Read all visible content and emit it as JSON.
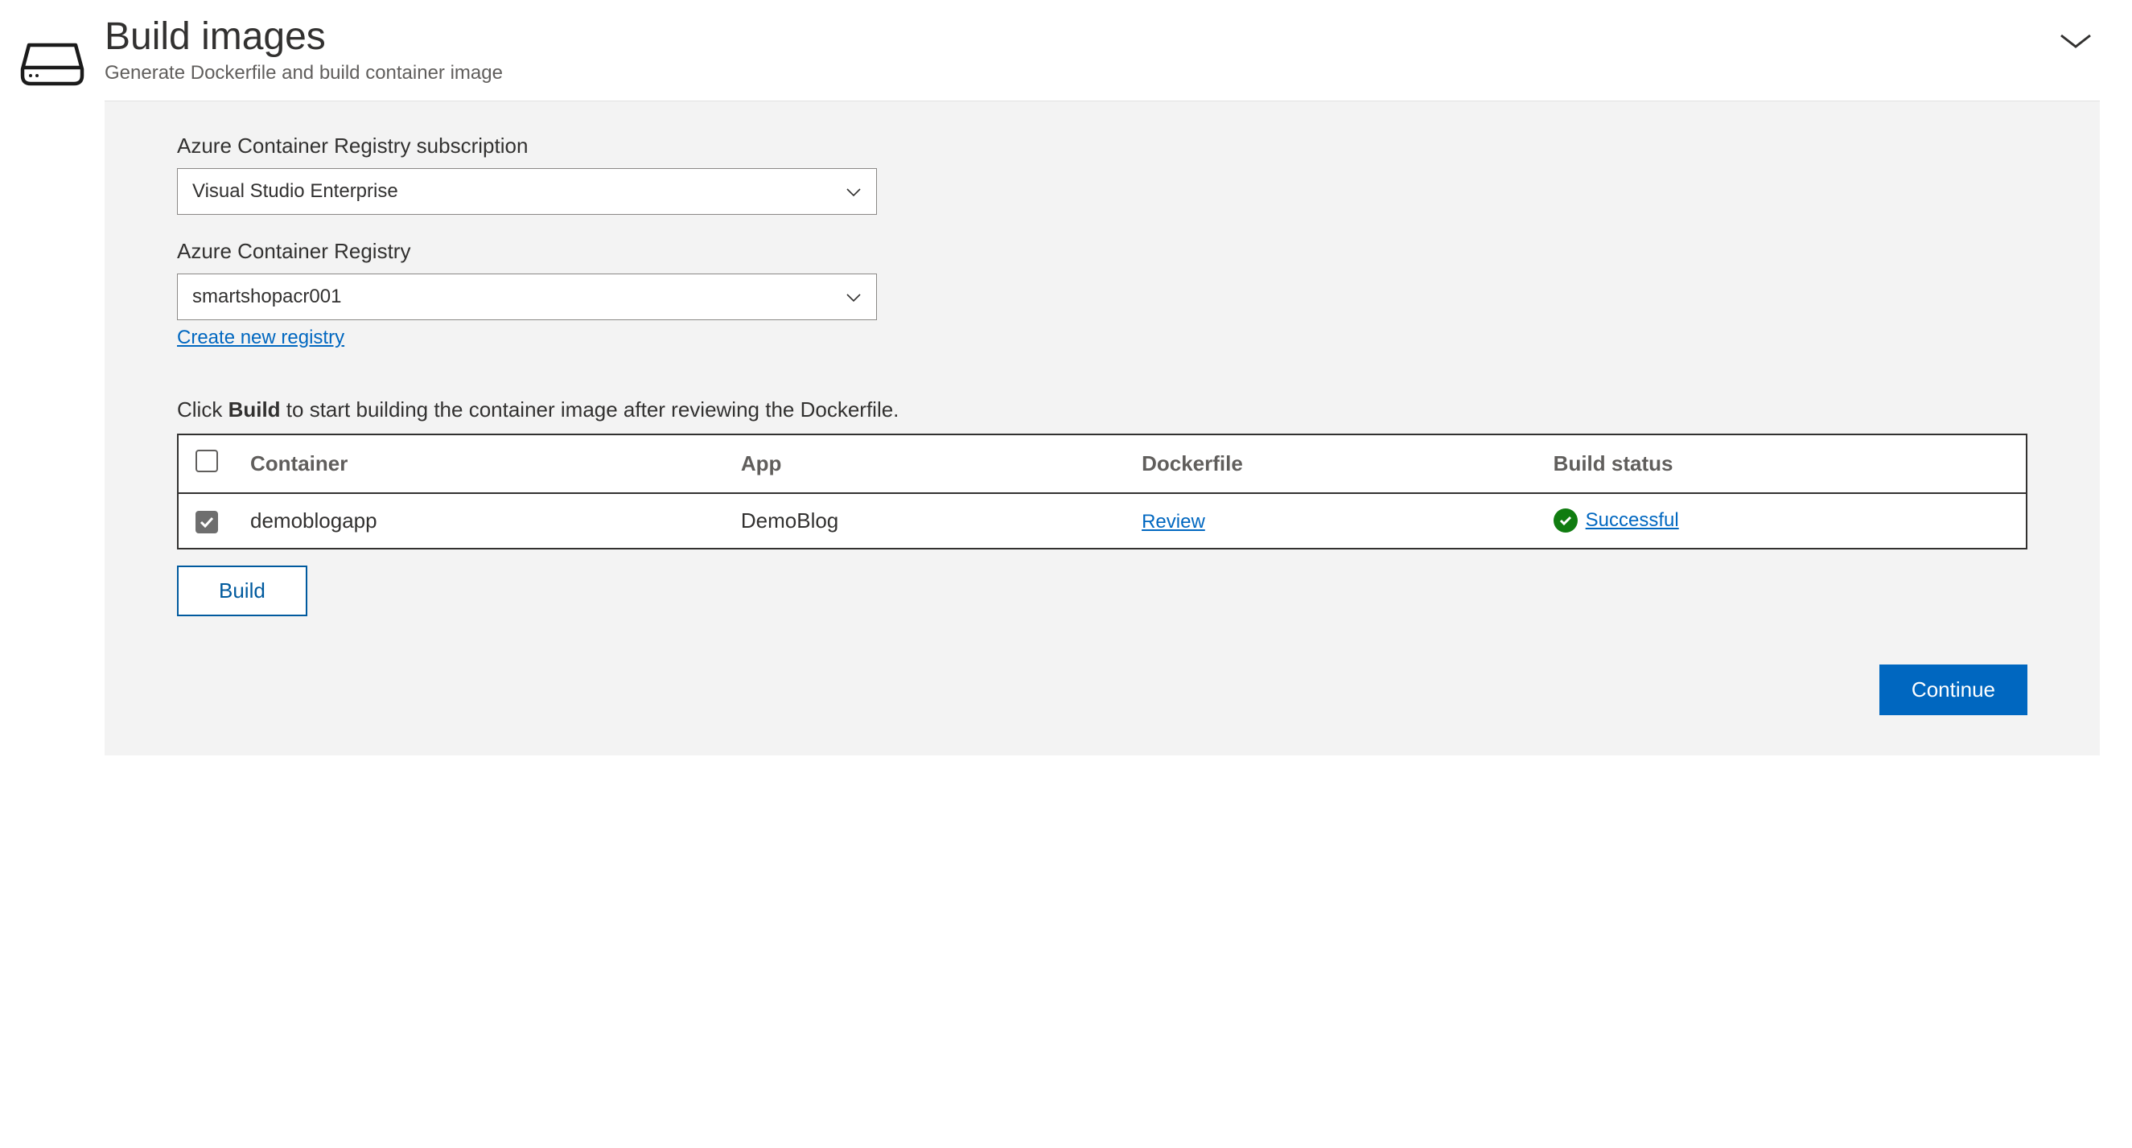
{
  "header": {
    "title": "Build images",
    "subtitle": "Generate Dockerfile and build container image"
  },
  "form": {
    "subscription": {
      "label": "Azure Container Registry subscription",
      "value": "Visual Studio Enterprise"
    },
    "registry": {
      "label": "Azure Container Registry",
      "value": "smartshopacr001",
      "create_link": "Create new registry"
    },
    "instruction_pre": "Click ",
    "instruction_bold": "Build",
    "instruction_post": " to start building the container image after reviewing the Dockerfile."
  },
  "table": {
    "headers": {
      "container": "Container",
      "app": "App",
      "dockerfile": "Dockerfile",
      "status": "Build status"
    },
    "row": {
      "checked": true,
      "container": "demoblogapp",
      "app": "DemoBlog",
      "dockerfile_link": "Review",
      "status_text": "Successful"
    }
  },
  "buttons": {
    "build": "Build",
    "continue": "Continue"
  }
}
